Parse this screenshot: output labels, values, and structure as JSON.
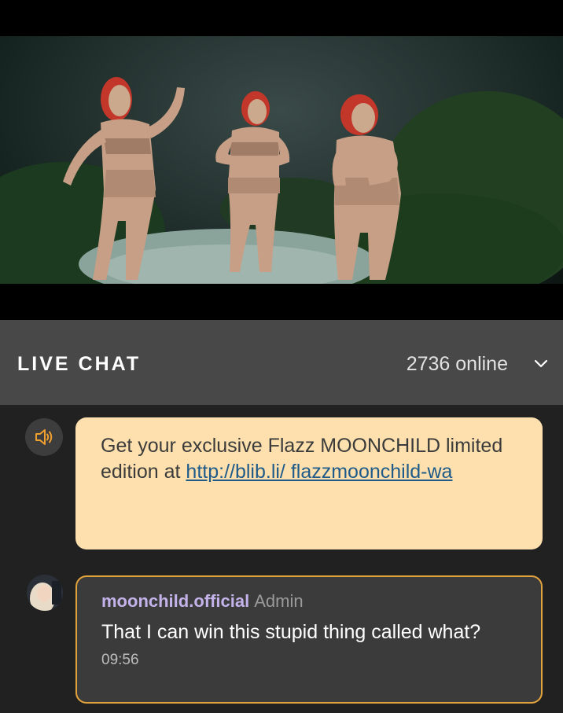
{
  "video": {
    "icon": "video-frame-dancers"
  },
  "live_chat": {
    "title": "LIVE CHAT",
    "online": "2736 online",
    "collapse_icon": "chevron-down-icon"
  },
  "announcement": {
    "icon": "speaker-icon",
    "text": "Get your exclusive Flazz MOONCHILD limited edition at ",
    "link": "http://blib.li/ flazzmoonchild-wa"
  },
  "message": {
    "username": "moonchild.official",
    "role": "Admin",
    "text": "That I can win this stupid thing called what?",
    "time": "09:56"
  },
  "colors": {
    "announcement_bg": "#fde0ad",
    "admin_border": "#e3a33c",
    "username": "#c4b3ea",
    "speaker_icon": "#f0a030"
  }
}
